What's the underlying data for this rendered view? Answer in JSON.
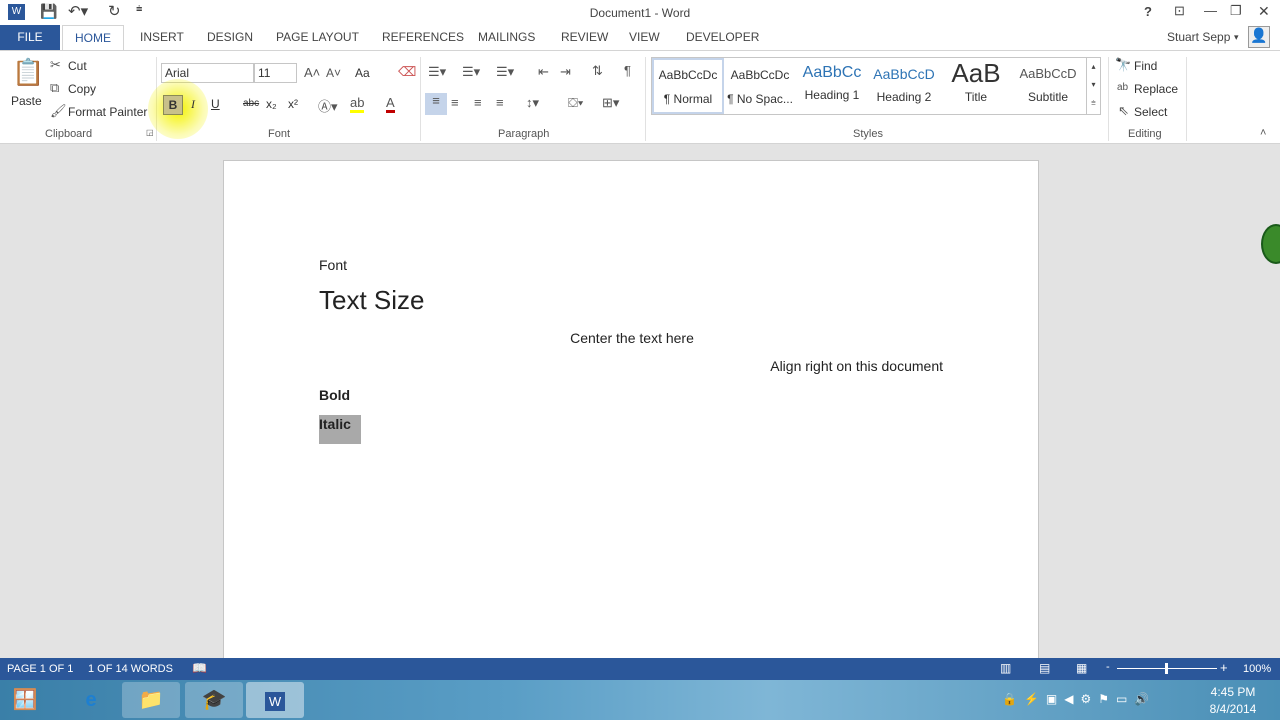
{
  "title": "Document1 - Word",
  "quick_access": {
    "save": "save-icon",
    "undo": "undo-icon",
    "redo": "redo-icon"
  },
  "window_controls": {
    "help": "?",
    "restore": "🗗",
    "minimize": "—",
    "maximize": "🗗",
    "close": "✕"
  },
  "tabs": [
    "FILE",
    "HOME",
    "INSERT",
    "DESIGN",
    "PAGE LAYOUT",
    "REFERENCES",
    "MAILINGS",
    "REVIEW",
    "VIEW",
    "DEVELOPER"
  ],
  "user": "Stuart Sepp",
  "clipboard": {
    "paste": "Paste",
    "cut": "Cut",
    "copy": "Copy",
    "format_painter": "Format Painter",
    "label": "Clipboard"
  },
  "font": {
    "name": "Arial",
    "size": "11",
    "label": "Font",
    "case": "Aa",
    "bold": "B",
    "italic": "I",
    "underline": "U",
    "strike": "abc",
    "sub": "x₂",
    "sup": "x²",
    "color": "#c00000"
  },
  "paragraph": {
    "label": "Paragraph"
  },
  "styles": {
    "label": "Styles",
    "items": [
      {
        "preview": "AaBbCcDc",
        "name": "¶ Normal"
      },
      {
        "preview": "AaBbCcDc",
        "name": "¶ No Spac..."
      },
      {
        "preview": "AaBbCc",
        "name": "Heading 1"
      },
      {
        "preview": "AaBbCcD",
        "name": "Heading 2"
      },
      {
        "preview": "AaB",
        "name": "Title"
      },
      {
        "preview": "AaBbCcD",
        "name": "Subtitle"
      }
    ]
  },
  "editing": {
    "find": "Find",
    "replace": "Replace",
    "select": "Select",
    "label": "Editing"
  },
  "document": {
    "line1": "Font",
    "line2": "Text Size",
    "line3": "Center the text here",
    "line4": "Align right on this document",
    "line5": "Bold",
    "line6": "Italic"
  },
  "status": {
    "page": "PAGE 1 OF 1",
    "words": "1 OF 14 WORDS",
    "zoom": "100%",
    "zoom_value": 100
  },
  "taskbar": {
    "time": "4:45 PM",
    "date": "8/4/2014"
  },
  "colors": {
    "accent": "#2b579a"
  }
}
